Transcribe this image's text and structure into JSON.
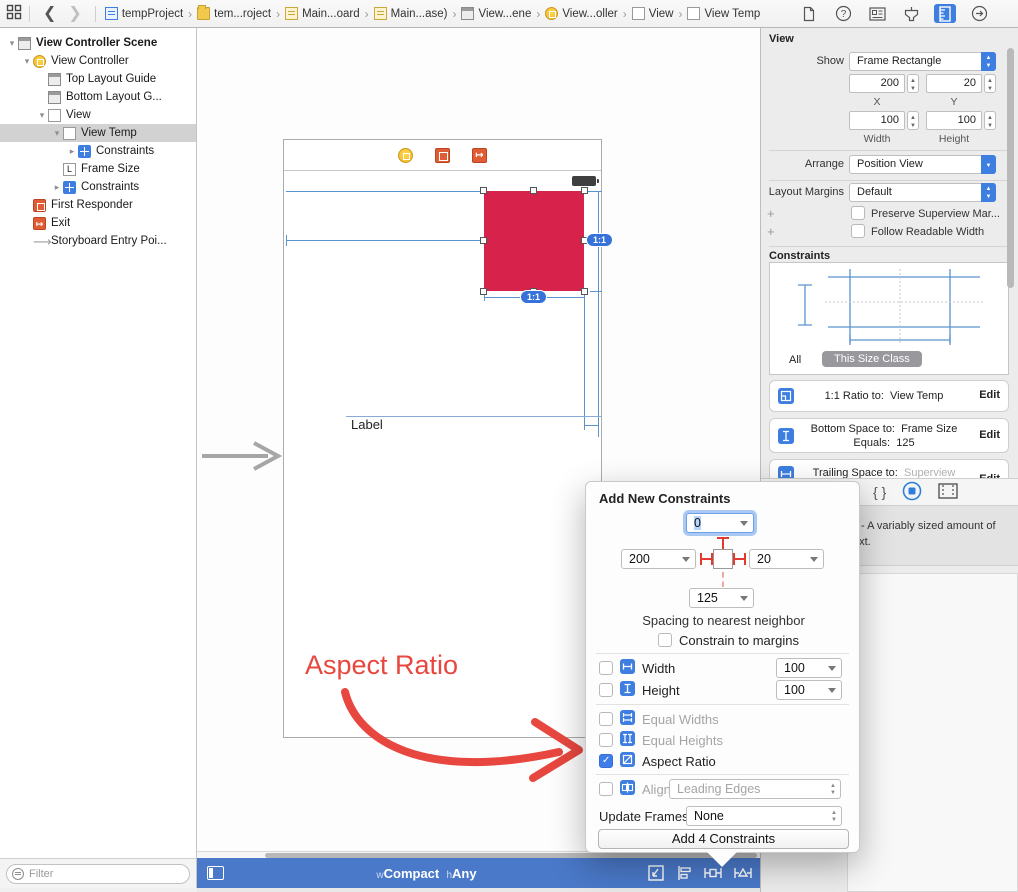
{
  "toolbar": {
    "breadcrumbs": [
      {
        "label": "tempProject"
      },
      {
        "label": "tem...roject"
      },
      {
        "label": "Main...oard"
      },
      {
        "label": "Main...ase)"
      },
      {
        "label": "View...ene"
      },
      {
        "label": "View...oller"
      },
      {
        "label": "View"
      },
      {
        "label": "View Temp"
      }
    ]
  },
  "outline": {
    "items": [
      {
        "label": "View Controller Scene"
      },
      {
        "label": "View Controller"
      },
      {
        "label": "Top Layout Guide"
      },
      {
        "label": "Bottom Layout G..."
      },
      {
        "label": "View"
      },
      {
        "label": "View Temp"
      },
      {
        "label": "Constraints"
      },
      {
        "label": "Frame Size"
      },
      {
        "label": "Constraints"
      },
      {
        "label": "First Responder"
      },
      {
        "label": "Exit"
      },
      {
        "label": "Storyboard Entry Poi..."
      }
    ],
    "filter_placeholder": "Filter"
  },
  "canvas": {
    "label_text": "Label",
    "annotation_text": "Aspect Ratio",
    "badge_right": "1:1",
    "badge_bottom": "1:1",
    "trait_w_key": "w",
    "trait_w_val": "Compact",
    "trait_h_key": "h",
    "trait_h_val": "Any"
  },
  "inspector": {
    "view_title": "View",
    "show_label": "Show",
    "show_value": "Frame Rectangle",
    "x_value": "200",
    "x_label": "X",
    "y_value": "20",
    "y_label": "Y",
    "w_value": "100",
    "w_label": "Width",
    "h_value": "100",
    "h_label": "Height",
    "arrange_label": "Arrange",
    "arrange_value": "Position View",
    "margins_label": "Layout Margins",
    "margins_value": "Default",
    "plus": "+",
    "cb_preserve": "Preserve Superview Mar...",
    "cb_readable": "Follow Readable Width",
    "constraints_title": "Constraints",
    "seg_all": "All",
    "seg_size_class": "This Size Class",
    "cards": [
      {
        "l1a": "1:1 Ratio to:",
        "l1b": "View Temp",
        "edit": "Edit"
      },
      {
        "l1a": "Bottom Space to:",
        "l1b": "Frame Size",
        "l2a": "Equals:",
        "l2b": "125",
        "edit": "Edit"
      },
      {
        "l1a": "Trailing Space to:",
        "l1b": "Superview",
        "edit": "Edit"
      }
    ],
    "library_line1": "- A variably sized amount of",
    "library_line2": "ext."
  },
  "popover": {
    "title": "Add New Constraints",
    "top_value": "0",
    "leading_value": "200",
    "trailing_value": "20",
    "bottom_value": "125",
    "spacing_caption": "Spacing to nearest neighbor",
    "margins_label": "Constrain to margins",
    "width_label": "Width",
    "width_value": "100",
    "height_label": "Height",
    "height_value": "100",
    "equal_widths_label": "Equal Widths",
    "equal_heights_label": "Equal Heights",
    "aspect_ratio_label": "Aspect Ratio",
    "align_label": "Align",
    "align_value": "Leading Edges",
    "update_frames_label": "Update Frames",
    "update_frames_value": "None",
    "add_button_label": "Add 4 Constraints"
  }
}
